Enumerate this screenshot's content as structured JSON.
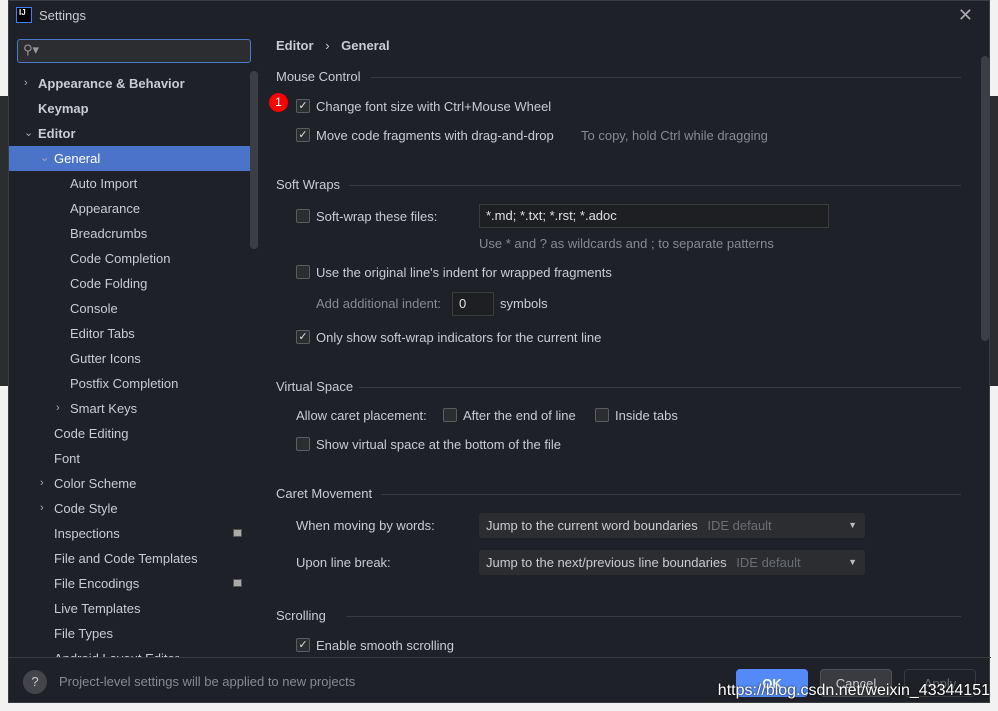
{
  "window": {
    "title": "Settings",
    "logo": "IJ"
  },
  "search": {
    "placeholder": ""
  },
  "tree": [
    {
      "label": "Appearance & Behavior",
      "bold": true,
      "arrow": "›",
      "level": 0
    },
    {
      "label": "Keymap",
      "bold": true,
      "arrow": "",
      "level": 0
    },
    {
      "label": "Editor",
      "bold": true,
      "arrow": "⌄",
      "level": 0
    },
    {
      "label": "General",
      "arrow": "⌄",
      "level": 1,
      "selected": true
    },
    {
      "label": "Auto Import",
      "level": 2
    },
    {
      "label": "Appearance",
      "level": 2
    },
    {
      "label": "Breadcrumbs",
      "level": 2
    },
    {
      "label": "Code Completion",
      "level": 2
    },
    {
      "label": "Code Folding",
      "level": 2
    },
    {
      "label": "Console",
      "level": 2
    },
    {
      "label": "Editor Tabs",
      "level": 2
    },
    {
      "label": "Gutter Icons",
      "level": 2
    },
    {
      "label": "Postfix Completion",
      "level": 2
    },
    {
      "label": "Smart Keys",
      "arrow": "›",
      "level": 2
    },
    {
      "label": "Code Editing",
      "level": 1
    },
    {
      "label": "Font",
      "level": 1
    },
    {
      "label": "Color Scheme",
      "arrow": "›",
      "level": 1
    },
    {
      "label": "Code Style",
      "arrow": "›",
      "level": 1
    },
    {
      "label": "Inspections",
      "level": 1,
      "badge": true
    },
    {
      "label": "File and Code Templates",
      "level": 1
    },
    {
      "label": "File Encodings",
      "level": 1,
      "badge": true
    },
    {
      "label": "Live Templates",
      "level": 1
    },
    {
      "label": "File Types",
      "level": 1
    },
    {
      "label": "Android Layout Editor",
      "level": 1
    }
  ],
  "breadcrumb": {
    "parent": "Editor",
    "sep": "›",
    "current": "General"
  },
  "annotation_badge": "1",
  "mouse": {
    "title": "Mouse Control",
    "change_font": "Change font size with Ctrl+Mouse Wheel",
    "move_code": "Move code fragments with drag-and-drop",
    "move_hint": "To copy, hold Ctrl while dragging"
  },
  "soft": {
    "title": "Soft Wraps",
    "files_label": "Soft-wrap these files:",
    "files_value": "*.md; *.txt; *.rst; *.adoc",
    "files_hint": "Use * and ? as wildcards and ; to separate patterns",
    "indent_label": "Use the original line's indent for wrapped fragments",
    "add_indent": "Add additional indent:",
    "add_indent_value": "0",
    "symbols": "symbols",
    "only_show": "Only show soft-wrap indicators for the current line"
  },
  "virtual": {
    "title": "Virtual Space",
    "allow": "Allow caret placement:",
    "after_end": "After the end of line",
    "inside_tabs": "Inside tabs",
    "show_bottom": "Show virtual space at the bottom of the file"
  },
  "caret": {
    "title": "Caret Movement",
    "words_label": "When moving by words:",
    "words_value": "Jump to the current word boundaries",
    "words_default": "IDE default",
    "break_label": "Upon line break:",
    "break_value": "Jump to the next/previous line boundaries",
    "break_default": "IDE default"
  },
  "scrolling": {
    "title": "Scrolling",
    "smooth": "Enable smooth scrolling"
  },
  "footer": {
    "help": "?",
    "message": "Project-level settings will be applied to new projects",
    "ok": "OK",
    "cancel": "Cancel",
    "apply": "Apply"
  },
  "watermark": "https://blog.csdn.net/weixin_43344151"
}
